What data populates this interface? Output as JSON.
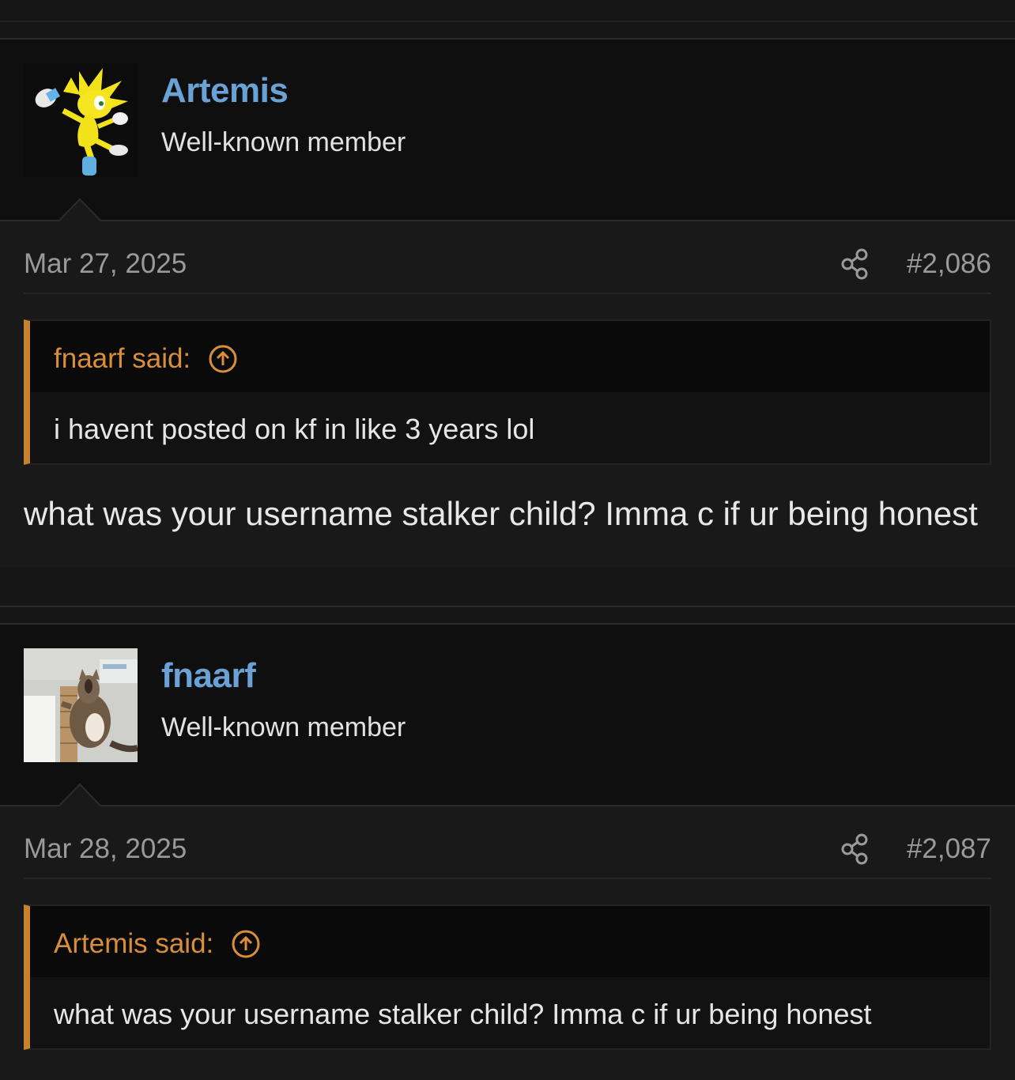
{
  "posts": [
    {
      "username": "Artemis",
      "user_title": "Well-known member",
      "avatar_icon": "yellow-hedgehog-avatar",
      "date": "Mar 27, 2025",
      "post_number": "#2,086",
      "quote": {
        "author": "fnaarf said:",
        "text": "i havent posted on kf in like 3 years lol"
      },
      "message": "what was your username stalker child? Imma c if ur being honest"
    },
    {
      "username": "fnaarf",
      "user_title": "Well-known member",
      "avatar_icon": "screaming-cat-avatar",
      "date": "Mar 28, 2025",
      "post_number": "#2,087",
      "quote": {
        "author": "Artemis said:",
        "text": "what was your username stalker child? Imma c if ur being honest"
      },
      "message": ""
    }
  ],
  "colors": {
    "username": "#6aa2d6",
    "quote_author": "#d98f3a",
    "quote_bar": "#c6822f",
    "background": "#191919"
  }
}
